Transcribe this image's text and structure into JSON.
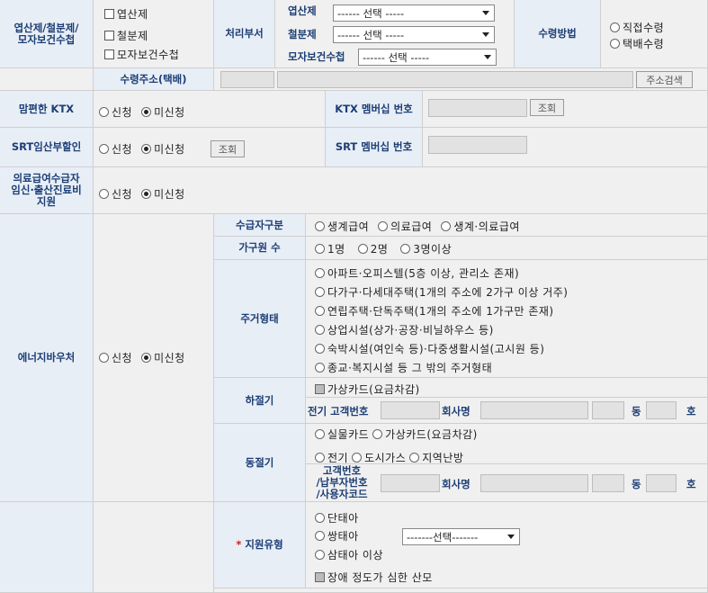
{
  "row_birth": {
    "label": "엽산제/철분제/\n모자보건수첩",
    "items": [
      "엽산제",
      "철분제",
      "모자보건수첩"
    ],
    "dept_label": "처리부서",
    "dept_fields": [
      {
        "label": "엽산제",
        "select": "------ 선택 -----"
      },
      {
        "label": "철분제",
        "select": "------ 선택 -----"
      },
      {
        "label": "모자보건수첩",
        "select": "------ 선택 -----"
      }
    ],
    "receive_label": "수령방법",
    "receive_options": [
      "직접수령",
      "택배수령"
    ]
  },
  "address": {
    "label": "수령주소(택배)",
    "search_button": "주소검색"
  },
  "ktx": {
    "label": "맘편한 KTX",
    "options": [
      "신청",
      "미신청"
    ],
    "selected": "미신청",
    "member_label": "KTX 멤버십 번호",
    "lookup_button": "조회"
  },
  "srt": {
    "label": "SRT임산부할인",
    "options": [
      "신청",
      "미신청"
    ],
    "selected": "미신청",
    "lookup_button": "조회",
    "member_label": "SRT 멤버십 번호"
  },
  "medical": {
    "label": "의료급여수급자\n임신·출산진료비\n지원",
    "options": [
      "신청",
      "미신청"
    ],
    "selected": "미신청"
  },
  "energy": {
    "label": "에너지바우처",
    "options": [
      "신청",
      "미신청"
    ],
    "selected": "미신청",
    "benefit_label": "수급자구분",
    "benefit_options": [
      "생계급여",
      "의료급여",
      "생계·의료급여"
    ],
    "household_label": "가구원 수",
    "household_options": [
      "1명",
      "2명",
      "3명이상"
    ],
    "housing_label": "주거형태",
    "housing_options": [
      "아파트·오피스텔(5층 이상, 관리소 존재)",
      "다가구·다세대주택(1개의 주소에 2가구 이상 거주)",
      "연립주택·단독주택(1개의 주소에 1가구만 존재)",
      "상업시설(상가·공장·비닐하우스 등)",
      "숙박시설(여인숙 등)·다중생활시설(고시원 등)",
      "종교·복지시설 등 그 밖의 주거형태"
    ],
    "summer_label": "하절기",
    "summer_card": "가상카드(요금차감)",
    "summer_customer_label": "전기 고객번호",
    "summer_company_label": "회사명",
    "dong": "동",
    "ho": "호",
    "winter_label": "동절기",
    "winter_cards": [
      "실물카드",
      "가상카드(요금차감)"
    ],
    "winter_fuels": [
      "전기",
      "도시가스",
      "지역난방"
    ],
    "winter_customer_label": "고객번호\n/납부자번호\n/사용자코드",
    "winter_company_label": "회사명"
  },
  "support": {
    "label": "지원유형",
    "required_mark": "*",
    "options": [
      "단태아",
      "쌍태아",
      "삼태아 이상"
    ],
    "select": "-------선택-------",
    "disability": "장애 정도가 심한 산모"
  }
}
